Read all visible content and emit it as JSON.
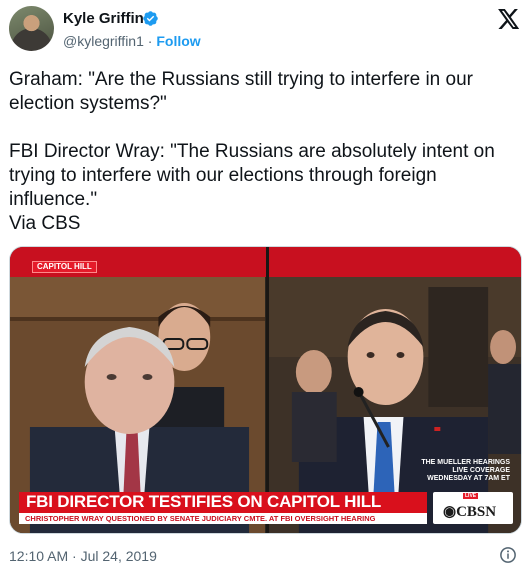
{
  "author": {
    "name": "Kyle Griffin",
    "handle": "@kylegriffin1",
    "separator": " · ",
    "follow_label": "Follow",
    "avatar_icon": "profile-photo",
    "verified_icon": "verified-badge-icon",
    "verified_color": "#1d9bf0"
  },
  "platform": {
    "logo_icon": "x-logo-icon"
  },
  "tweet": {
    "line1": "Graham: \"Are the Russians still trying to interfere in our election systems?\"",
    "line2": "FBI Director Wray: \"The Russians are absolutely intent on trying to interfere with our elections through foreign influence.\"",
    "line3": "Via CBS"
  },
  "media": {
    "tag": "CAPITOL HILL",
    "headline": "FBI DIRECTOR TESTIFIES ON CAPITOL HILL",
    "subheadline": "CHRISTOPHER WRAY QUESTIONED BY SENATE JUDICIARY CMTE. AT FBI OVERSIGHT HEARING",
    "promo_line1": "THE MUELLER HEARINGS",
    "promo_line2": "LIVE COVERAGE",
    "promo_line3": "WEDNESDAY AT 7AM ET",
    "live_label": "LIVE",
    "network": "CBSN",
    "accent_color": "#d9101c"
  },
  "footer": {
    "timestamp": "12:10 AM · Jul 24, 2019",
    "info_icon": "info-icon"
  }
}
